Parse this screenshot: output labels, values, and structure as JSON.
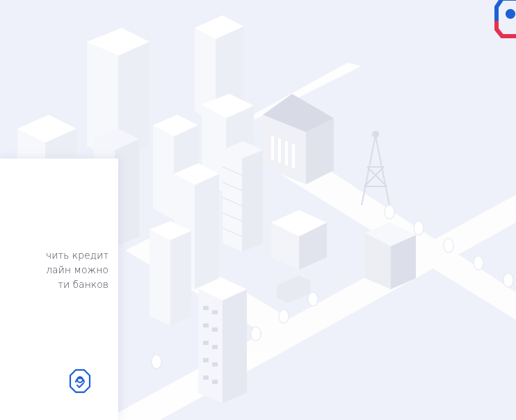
{
  "card": {
    "lines": [
      "чить кредит",
      "лайн можно",
      "ти банков"
    ]
  },
  "icons": {
    "top_right": "gosuslugi-biometry-logo",
    "card": "face-check-icon"
  },
  "colors": {
    "background": "#eef0fa",
    "card": "#ffffff",
    "text": "#3f4350",
    "accent_blue": "#1d5fd6",
    "accent_red": "#e7304e"
  }
}
